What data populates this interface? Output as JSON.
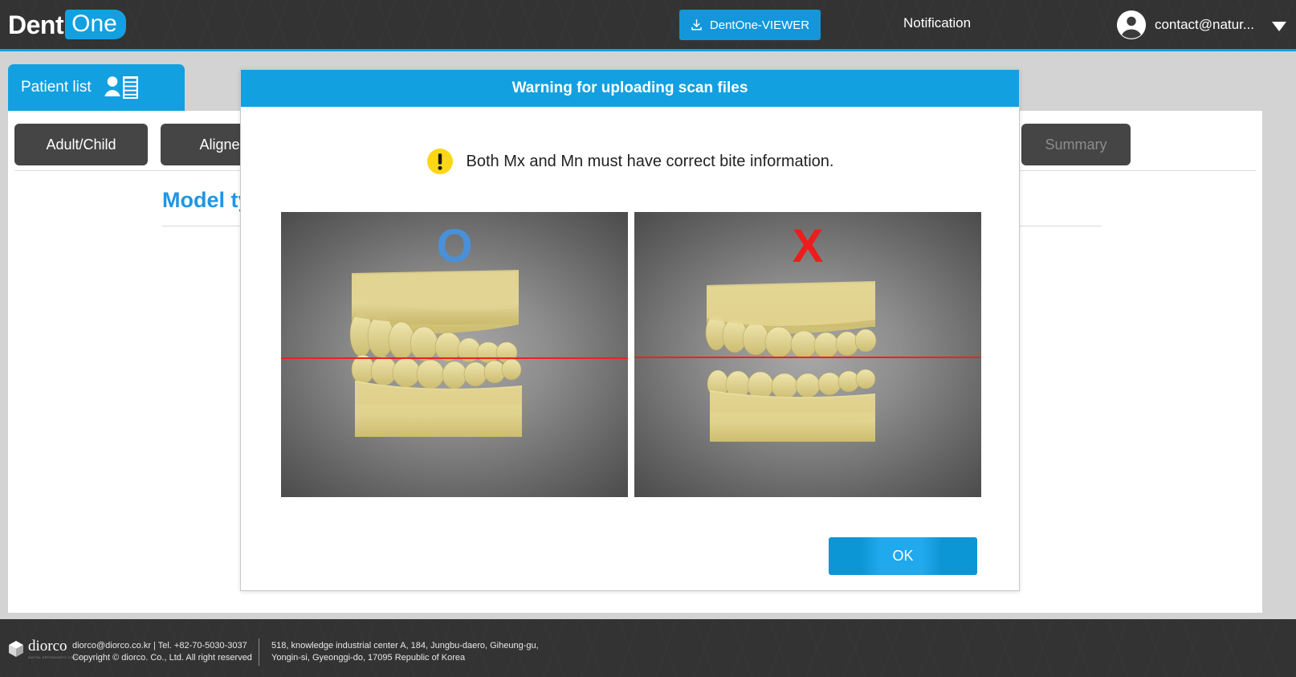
{
  "header": {
    "logo_primary": "Dent",
    "logo_secondary": "One",
    "viewer_button": "DentOne-VIEWER",
    "viewer_icon": "download-icon",
    "notification": "Notification",
    "user_email": "contact@natur...",
    "user_icon": "user-avatar-icon",
    "dropdown_icon": "chevron-down-icon"
  },
  "patient_tab": {
    "label": "Patient list",
    "icon": "patient-list-icon"
  },
  "content": {
    "tabs": [
      {
        "label": "Adult/Child",
        "enabled": true
      },
      {
        "label": "Aligner st",
        "enabled": true
      }
    ],
    "summary_button": "Summary",
    "section_title": "Model ty"
  },
  "modal": {
    "title": "Warning for uploading scan files",
    "warning_icon": "exclamation-circle-icon",
    "message": "Both Mx and Mn must have correct bite information.",
    "examples": [
      {
        "mark": "O",
        "mark_color": "#4a90d9",
        "state": "correct-bite",
        "caption": ""
      },
      {
        "mark": "X",
        "mark_color": "#ee1c1c",
        "state": "incorrect-bite",
        "caption": ""
      }
    ],
    "ok_button": "OK"
  },
  "footer": {
    "brand": "diorco",
    "brand_sub": "DIGITAL ORTHODONTIC COMPANY",
    "brand_icon": "cube-logo-icon",
    "contact_line1": "diorco@diorco.co.kr  |  Tel. +82-70-5030-3037",
    "contact_line2": "Copyright © diorco. Co., Ltd. All right reserved",
    "address_line1": "518, knowledge industrial center A, 184, Jungbu-daero, Giheung-gu,",
    "address_line2": "Yongin-si, Gyeonggi-do, 17095 Republic of Korea"
  },
  "colors": {
    "accent_blue": "#12a0e0",
    "header_dark": "#333333",
    "tab_dark": "#454545",
    "warn_yellow": "#fcd716",
    "error_red": "#ee1c1c"
  }
}
